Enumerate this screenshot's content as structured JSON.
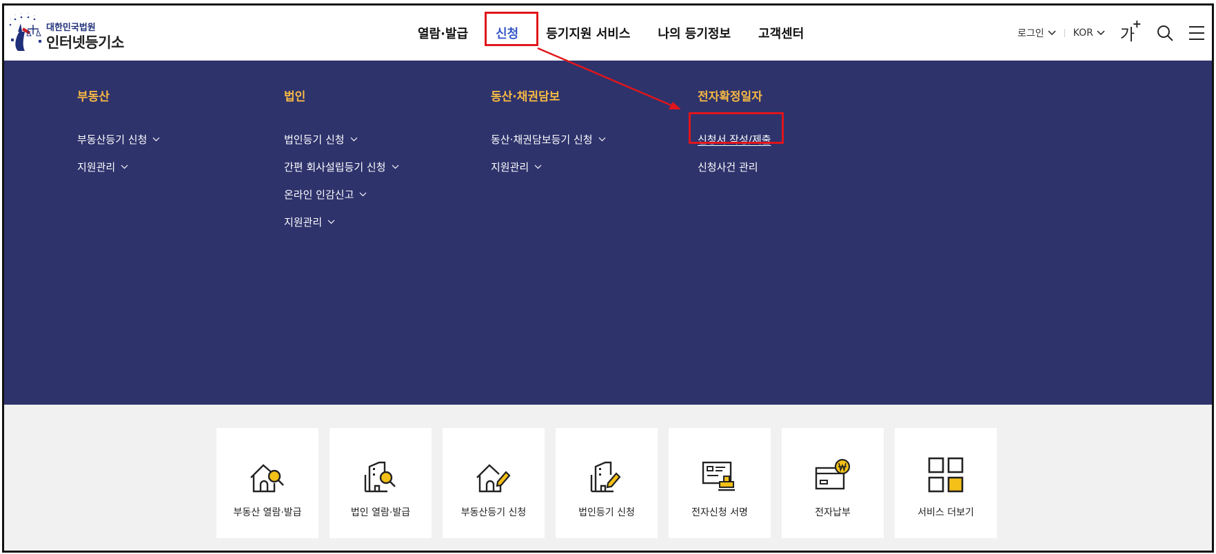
{
  "logo": {
    "sub": "대한민국법원",
    "main": "인터넷등기소"
  },
  "gnb": [
    "열람·발급",
    "신청",
    "등기지원 서비스",
    "나의 등기정보",
    "고객센터"
  ],
  "gnb_active_index": 1,
  "util": {
    "login": "로그인",
    "lang": "KOR",
    "font_size": "가",
    "font_plus": "+"
  },
  "mega": {
    "columns": [
      {
        "title": "부동산",
        "items": [
          {
            "label": "부동산등기 신청",
            "chevron": true
          },
          {
            "label": "지원관리",
            "chevron": true
          }
        ]
      },
      {
        "title": "법인",
        "items": [
          {
            "label": "법인등기 신청",
            "chevron": true
          },
          {
            "label": "간편 회사설립등기 신청",
            "chevron": true
          },
          {
            "label": "온라인 인감신고",
            "chevron": true
          },
          {
            "label": "지원관리",
            "chevron": true
          }
        ]
      },
      {
        "title": "동산·채권담보",
        "items": [
          {
            "label": "동산·채권담보등기 신청",
            "chevron": true
          },
          {
            "label": "지원관리",
            "chevron": true
          }
        ]
      },
      {
        "title": "전자확정일자",
        "items": [
          {
            "label": "신청서 작성/제출",
            "chevron": false
          },
          {
            "label": "신청사건 관리",
            "chevron": false
          }
        ]
      }
    ]
  },
  "quick": [
    {
      "label": "부동산 열람·발급",
      "icon": "house-search-icon"
    },
    {
      "label": "법인 열람·발급",
      "icon": "building-search-icon"
    },
    {
      "label": "부동산등기 신청",
      "icon": "house-pen-icon"
    },
    {
      "label": "법인등기 신청",
      "icon": "building-pen-icon"
    },
    {
      "label": "전자신청 서명",
      "icon": "document-stamp-icon"
    },
    {
      "label": "전자납부",
      "icon": "won-payment-icon"
    },
    {
      "label": "서비스 더보기",
      "icon": "grid-more-icon"
    }
  ],
  "colors": {
    "mega_bg": "#2e336c",
    "mega_title": "#f7b944",
    "highlight": "#e0151b",
    "active_nav": "#3556c7",
    "accent_yellow": "#f5c118"
  }
}
